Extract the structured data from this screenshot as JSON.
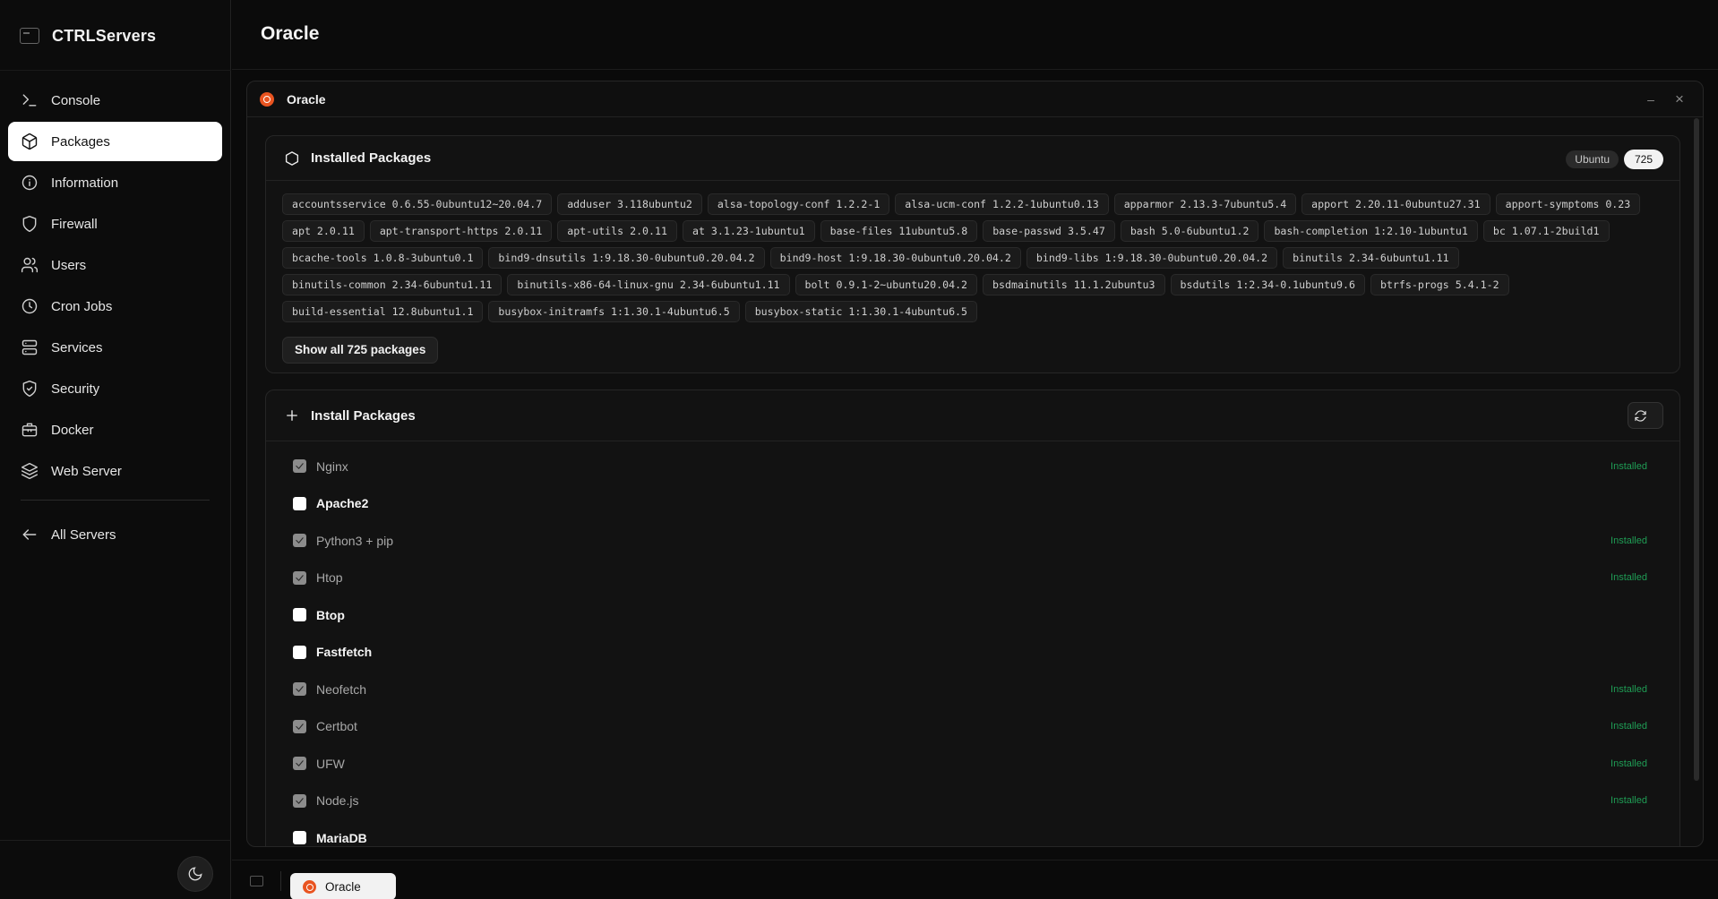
{
  "app": {
    "name": "CTRLServers"
  },
  "sidebar": {
    "items": [
      {
        "label": "Console",
        "icon": "terminal-icon",
        "active": false
      },
      {
        "label": "Packages",
        "icon": "package-icon",
        "active": true
      },
      {
        "label": "Information",
        "icon": "info-icon",
        "active": false
      },
      {
        "label": "Firewall",
        "icon": "shield-icon",
        "active": false
      },
      {
        "label": "Users",
        "icon": "users-icon",
        "active": false
      },
      {
        "label": "Cron Jobs",
        "icon": "clock-icon",
        "active": false
      },
      {
        "label": "Services",
        "icon": "server-icon",
        "active": false
      },
      {
        "label": "Security",
        "icon": "shield-check-icon",
        "active": false
      },
      {
        "label": "Docker",
        "icon": "docker-icon",
        "active": false
      },
      {
        "label": "Web Server",
        "icon": "layers-icon",
        "active": false
      }
    ],
    "back_label": "All Servers"
  },
  "header": {
    "title": "Oracle"
  },
  "window": {
    "title": "Oracle",
    "minimize": "–",
    "close": "×"
  },
  "installed": {
    "title": "Installed Packages",
    "os_badge": "Ubuntu",
    "count": "725",
    "lines": [
      [
        "accountsservice 0.6.55-0ubuntu12~20.04.7",
        "adduser 3.118ubuntu2",
        "alsa-topology-conf 1.2.2-1",
        "alsa-ucm-conf 1.2.2-1ubuntu0.13",
        "apparmor 2.13.3-7ubuntu5.4",
        "apport 2.20.11-0ubuntu27.31",
        "apport-symptoms 0.23"
      ],
      [
        "apt 2.0.11",
        "apt-transport-https 2.0.11",
        "apt-utils 2.0.11",
        "at 3.1.23-1ubuntu1",
        "base-files 11ubuntu5.8",
        "base-passwd 3.5.47",
        "bash 5.0-6ubuntu1.2",
        "bash-completion 1:2.10-1ubuntu1",
        "bc 1.07.1-2build1"
      ],
      [
        "bcache-tools 1.0.8-3ubuntu0.1",
        "bind9-dnsutils 1:9.18.30-0ubuntu0.20.04.2",
        "bind9-host 1:9.18.30-0ubuntu0.20.04.2",
        "bind9-libs 1:9.18.30-0ubuntu0.20.04.2",
        "binutils 2.34-6ubuntu1.11"
      ],
      [
        "binutils-common 2.34-6ubuntu1.11",
        "binutils-x86-64-linux-gnu 2.34-6ubuntu1.11",
        "bolt 0.9.1-2~ubuntu20.04.2",
        "bsdmainutils 11.1.2ubuntu3",
        "bsdutils 1:2.34-0.1ubuntu9.6",
        "btrfs-progs 5.4.1-2"
      ],
      [
        "build-essential 12.8ubuntu1.1",
        "busybox-initramfs 1:1.30.1-4ubuntu6.5",
        "busybox-static 1:1.30.1-4ubuntu6.5"
      ]
    ],
    "show_all": "Show all 725 packages"
  },
  "install": {
    "title": "Install Packages",
    "options": [
      {
        "label": "Nginx",
        "checked": true,
        "status": "Installed"
      },
      {
        "label": "Apache2",
        "checked": false,
        "status": ""
      },
      {
        "label": "Python3 + pip",
        "checked": true,
        "status": "Installed"
      },
      {
        "label": "Htop",
        "checked": true,
        "status": "Installed"
      },
      {
        "label": "Btop",
        "checked": false,
        "status": ""
      },
      {
        "label": "Fastfetch",
        "checked": false,
        "status": ""
      },
      {
        "label": "Neofetch",
        "checked": true,
        "status": "Installed"
      },
      {
        "label": "Certbot",
        "checked": true,
        "status": "Installed"
      },
      {
        "label": "UFW",
        "checked": true,
        "status": "Installed"
      },
      {
        "label": "Node.js",
        "checked": true,
        "status": "Installed"
      },
      {
        "label": "MariaDB",
        "checked": false,
        "status": ""
      }
    ]
  },
  "taskbar": {
    "tab_label": "Oracle"
  },
  "colors": {
    "accent": "#e95420",
    "installed": "#1f9d55",
    "active_nav": "#ffffff"
  }
}
